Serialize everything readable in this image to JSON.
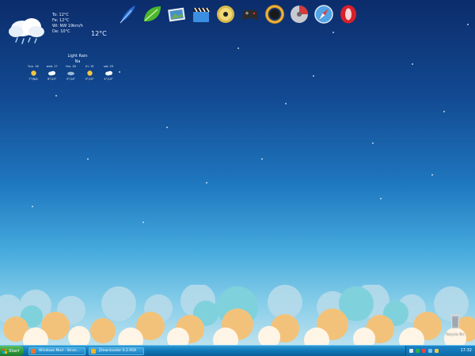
{
  "weather": {
    "lines": [
      "To: 12°C",
      "Fe: 12°C",
      "Wi: NW 19km/h",
      "De: 10°C"
    ],
    "current_temp": "12°C",
    "condition": "Light Rain",
    "location": "Na",
    "forecast": [
      {
        "day": "Sun. 16",
        "temps": "7°/N/A",
        "icon": "sun-icon"
      },
      {
        "day": "wed. 17",
        "temps": "6°/15°",
        "icon": "cloud-icon"
      },
      {
        "day": "thu. 18",
        "temps": "5°/14°",
        "icon": "cloud-icon"
      },
      {
        "day": "fri. 19",
        "temps": "5°/10°",
        "icon": "sun-icon"
      },
      {
        "day": "sat. 20",
        "temps": "4°/10°",
        "icon": "cloud-icon"
      }
    ]
  },
  "dock": {
    "icons": [
      "feather-icon",
      "leaf-icon",
      "photo-icon",
      "clapperboard-icon",
      "cd-icon",
      "gamepad-icon",
      "ring-icon",
      "dvd-icon",
      "compass-icon",
      "opera-icon"
    ]
  },
  "desktop": {
    "recycle_label": "Recycle Bin"
  },
  "taskbar": {
    "start_label": "Start",
    "tasks": [
      {
        "label": "Windows Mod - Stran..."
      },
      {
        "label": "jDownloader 0.2.958"
      }
    ],
    "clock": "17:32"
  },
  "colors": {
    "taskbar": "#1078b8",
    "start": "#2c9a3c",
    "sky_top": "#0c2c6b",
    "sky_bottom": "#cbe7ef"
  }
}
